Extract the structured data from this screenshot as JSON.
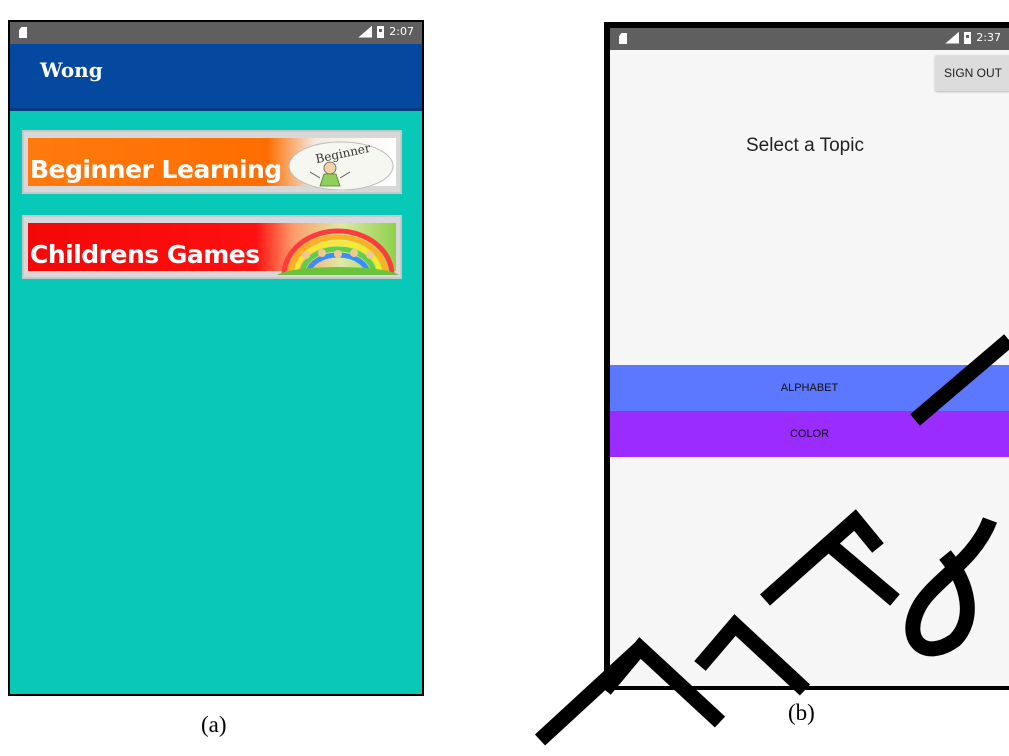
{
  "panel_a": {
    "status_time": "2:07",
    "app_title": "Wong",
    "banners": [
      {
        "label": "Beginner Learning",
        "badge": "Beginner"
      },
      {
        "label": "Childrens Games"
      }
    ],
    "caption": "(a)"
  },
  "panel_b": {
    "status_time": "2:37",
    "sign_out_label": "SIGN OUT",
    "heading": "Select a Topic",
    "topics": [
      "ALPHABET",
      "COLOR"
    ],
    "caption": "(b)"
  },
  "colors": {
    "appbar": "#0548a0",
    "teal_background": "#08c9b8",
    "alphabet_button": "#5c78ff",
    "color_button": "#9b2cff"
  }
}
